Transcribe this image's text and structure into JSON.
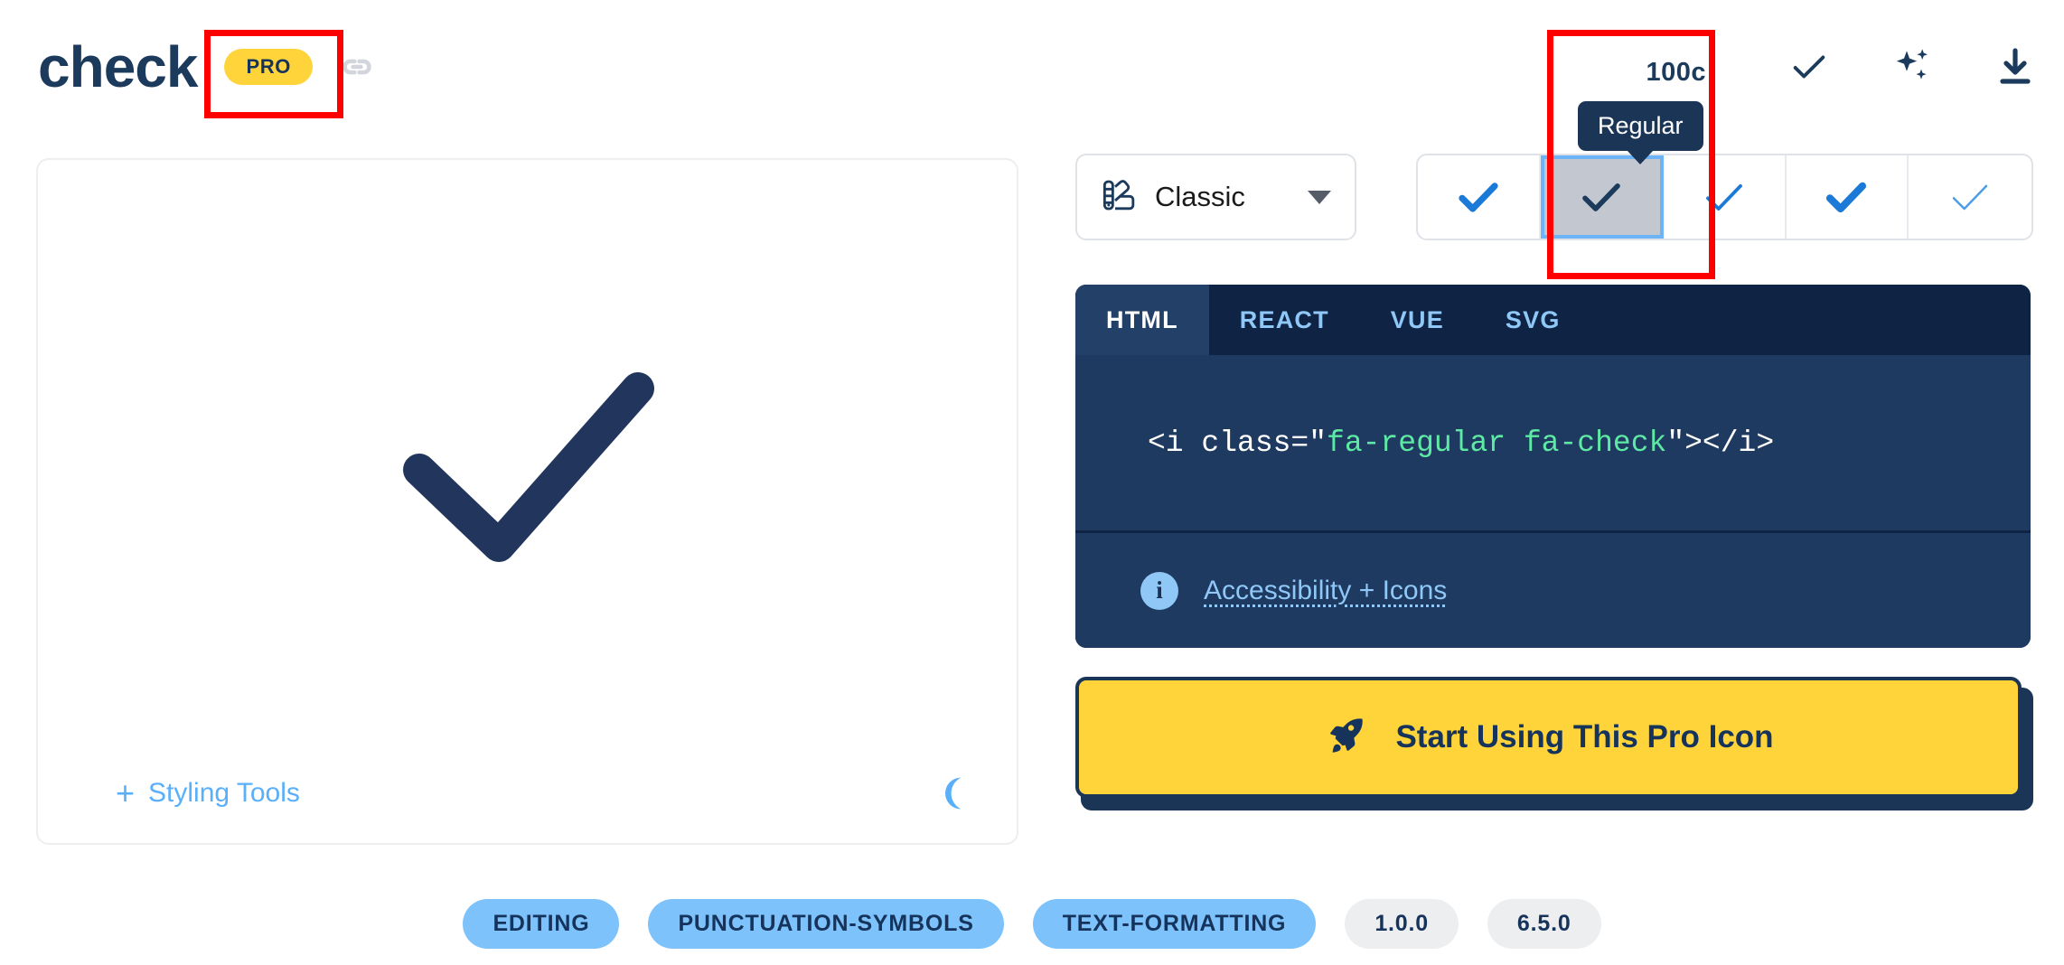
{
  "header": {
    "icon_name": "check",
    "pro_badge": "PRO",
    "link_icon": "link-icon",
    "partial_label": "100c",
    "tools": [
      {
        "name": "preview-check-icon",
        "label": "check"
      },
      {
        "name": "ai-sparkles-icon",
        "label": "sparkles"
      },
      {
        "name": "download-icon",
        "label": "download"
      }
    ]
  },
  "preview": {
    "icon_glyph": "check",
    "styling_tools_label": "Styling Tools",
    "plus": "+",
    "dark_mode_icon": "moon-icon"
  },
  "controls": {
    "family": {
      "icon": "swatch-icon",
      "value": "Classic",
      "caret": "chevron-down-icon"
    },
    "styles": [
      {
        "name": "solid",
        "selected": false
      },
      {
        "name": "regular",
        "selected": true
      },
      {
        "name": "light",
        "selected": false
      },
      {
        "name": "duotone",
        "selected": false
      },
      {
        "name": "thin",
        "selected": false
      }
    ],
    "tooltip": "Regular"
  },
  "code": {
    "tabs": [
      {
        "label": "HTML",
        "active": true
      },
      {
        "label": "REACT",
        "active": false
      },
      {
        "label": "VUE",
        "active": false
      },
      {
        "label": "SVG",
        "active": false
      }
    ],
    "snippet_prefix": "<i class=\"",
    "snippet_classes": "fa-regular fa-check",
    "snippet_suffix": "\"></i>",
    "a11y_icon": "info-icon",
    "a11y_link": "Accessibility + Icons"
  },
  "cta": {
    "icon": "rocket-icon",
    "label": "Start Using This Pro Icon"
  },
  "tags": {
    "categories": [
      "EDITING",
      "PUNCTUATION-SYMBOLS",
      "TEXT-FORMATTING"
    ],
    "versions": [
      "1.0.0",
      "6.5.0"
    ]
  },
  "colors": {
    "navy": "#1b3a5c",
    "yellow": "#ffd43b",
    "blue_accent": "#5aaffa",
    "code_bg": "#1e3a61",
    "annotation_red": "#ff0000"
  }
}
